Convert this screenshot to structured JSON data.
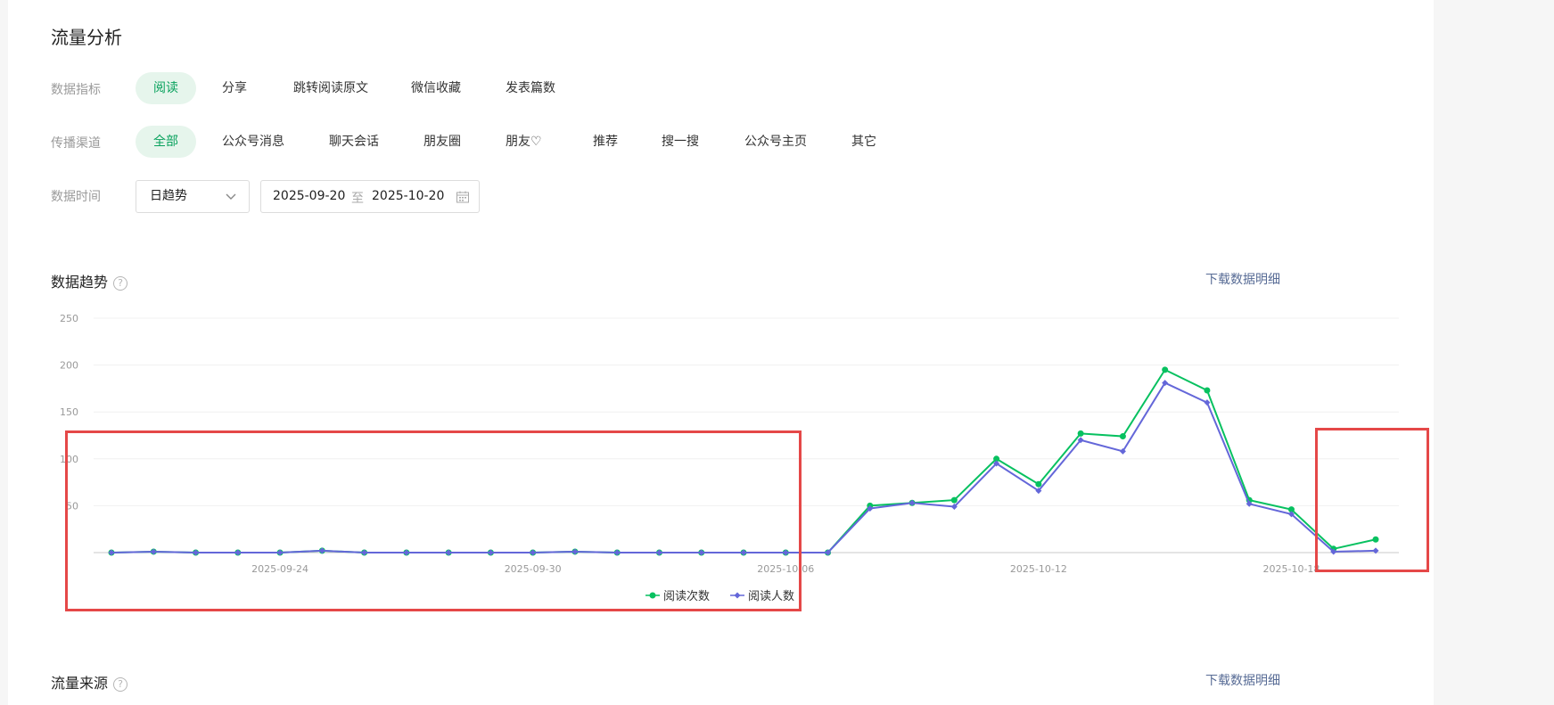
{
  "page": {
    "title": "流量分析"
  },
  "filters": {
    "metric": {
      "label": "数据指标",
      "options": [
        "阅读",
        "分享",
        "跳转阅读原文",
        "微信收藏",
        "发表篇数"
      ],
      "active": 0
    },
    "channel": {
      "label": "传播渠道",
      "options": [
        "全部",
        "公众号消息",
        "聊天会话",
        "朋友圈",
        "朋友♡",
        "推荐",
        "搜一搜",
        "公众号主页",
        "其它"
      ],
      "active": 0
    },
    "time": {
      "label": "数据时间",
      "granularity": "日趋势",
      "start": "2025-09-20",
      "separator": "至",
      "end": "2025-10-20"
    }
  },
  "trend": {
    "title": "数据趋势",
    "help": "?",
    "download": "下载数据明细"
  },
  "source": {
    "title": "流量来源",
    "help": "?",
    "download": "下载数据明细"
  },
  "colors": {
    "reads": "#07c160",
    "readers": "#6467d9",
    "annotation": "#e54848",
    "accent": "#07a15c"
  },
  "chart_data": {
    "type": "line",
    "ylim": [
      0,
      250
    ],
    "yticks": [
      50,
      100,
      150,
      200,
      250
    ],
    "yticks_shown": [
      "50",
      "100",
      "150",
      "200",
      "250"
    ],
    "x": [
      "2025-09-20",
      "2025-09-21",
      "2025-09-22",
      "2025-09-23",
      "2025-09-24",
      "2025-09-25",
      "2025-09-26",
      "2025-09-27",
      "2025-09-28",
      "2025-09-29",
      "2025-09-30",
      "2025-10-01",
      "2025-10-02",
      "2025-10-03",
      "2025-10-04",
      "2025-10-05",
      "2025-10-06",
      "2025-10-07",
      "2025-10-08",
      "2025-10-09",
      "2025-10-10",
      "2025-10-11",
      "2025-10-12",
      "2025-10-13",
      "2025-10-14",
      "2025-10-15",
      "2025-10-16",
      "2025-10-17",
      "2025-10-18",
      "2025-10-19",
      "2025-10-20"
    ],
    "x_tick_labels": [
      "2025-09-24",
      "2025-09-30",
      "2025-10-06",
      "2025-10-12",
      "2025-10-18"
    ],
    "legend_position": "bottom-center",
    "grid": true,
    "series": [
      {
        "name": "阅读次数",
        "marker": "circle",
        "values": [
          0,
          1,
          0,
          0,
          0,
          2,
          0,
          0,
          0,
          0,
          0,
          1,
          0,
          0,
          0,
          0,
          0,
          0,
          50,
          53,
          56,
          100,
          73,
          127,
          124,
          195,
          173,
          56,
          46,
          4,
          14
        ]
      },
      {
        "name": "阅读人数",
        "marker": "diamond",
        "values": [
          0,
          1,
          0,
          0,
          0,
          2,
          0,
          0,
          0,
          0,
          0,
          1,
          0,
          0,
          0,
          0,
          0,
          0,
          47,
          53,
          49,
          95,
          66,
          120,
          108,
          181,
          160,
          52,
          41,
          1,
          2
        ]
      }
    ]
  }
}
